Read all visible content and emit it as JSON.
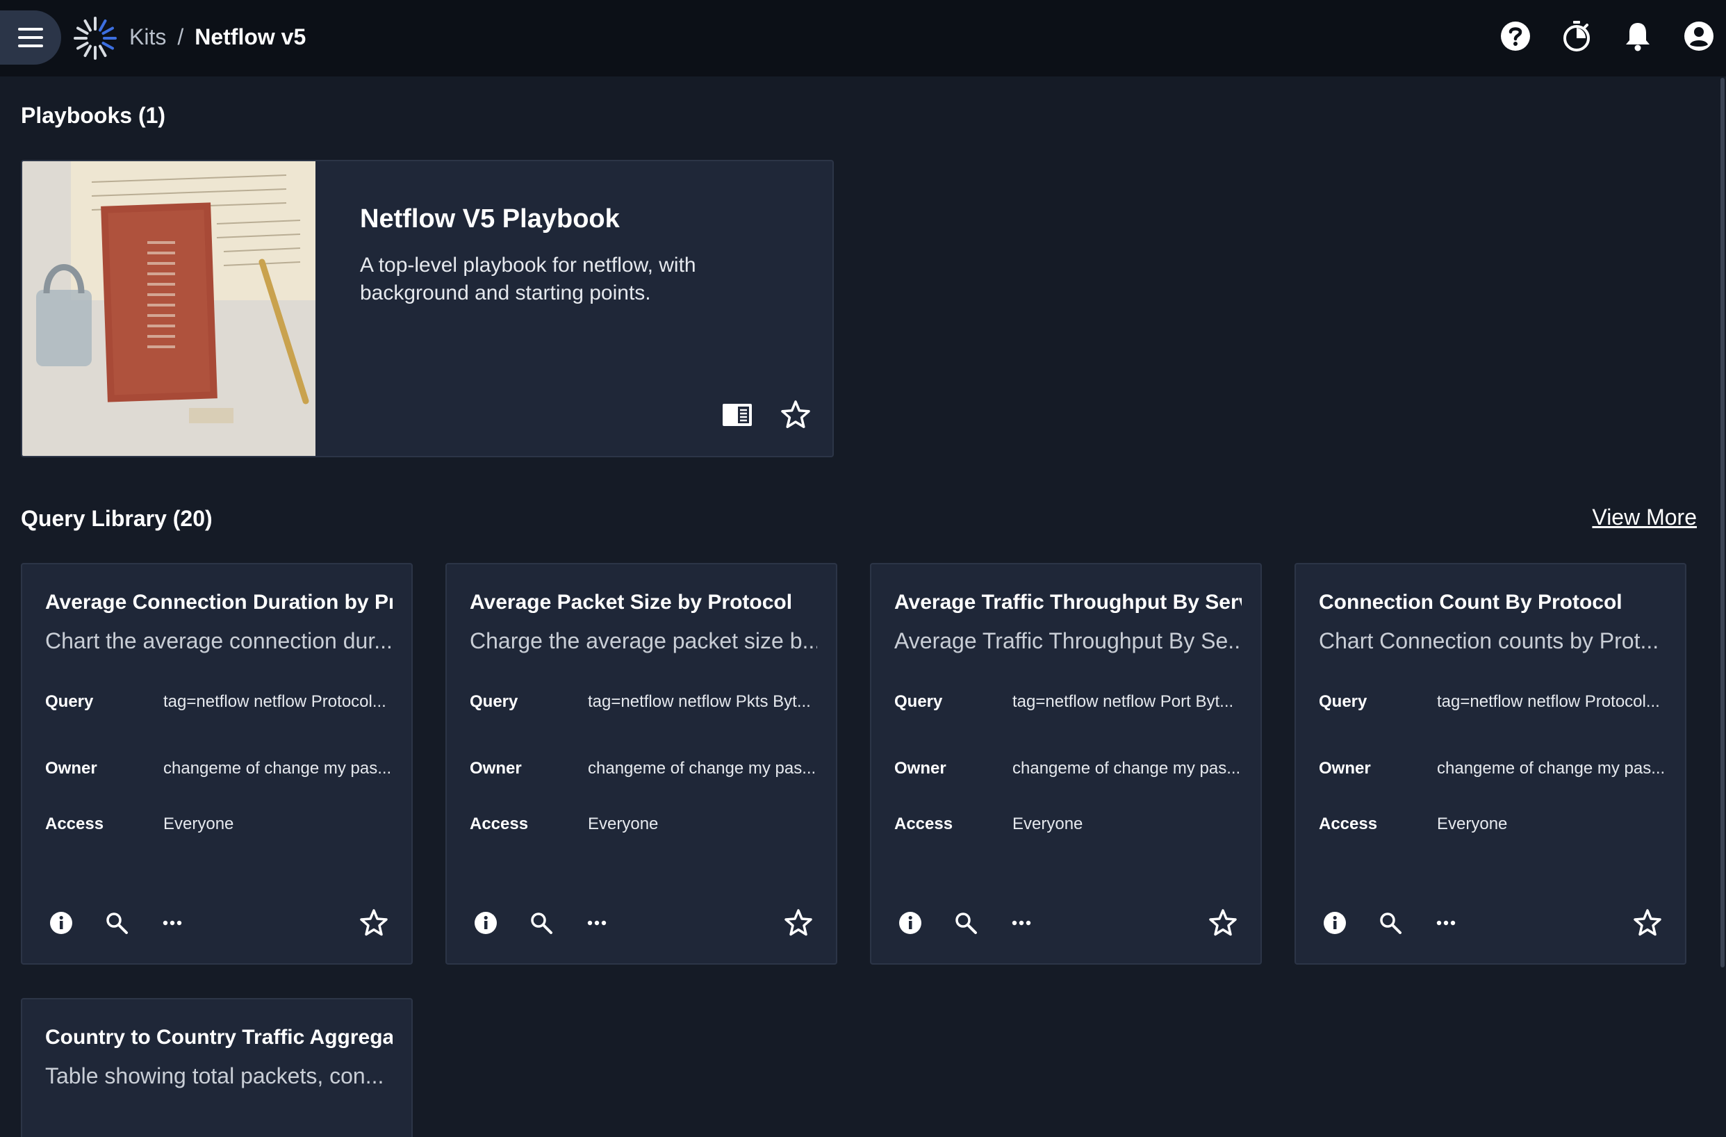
{
  "header": {
    "breadcrumb_parent": "Kits",
    "breadcrumb_separator": "/",
    "breadcrumb_current": "Netflow v5",
    "icons": [
      "help-icon",
      "timer-icon",
      "notifications-icon",
      "account-icon"
    ]
  },
  "playbooks": {
    "heading": "Playbooks (1)",
    "card": {
      "title": "Netflow V5 Playbook",
      "description": "A top-level playbook for netflow, with background and starting points."
    }
  },
  "query_library": {
    "heading": "Query Library (20)",
    "view_more": "View More",
    "labels": {
      "query": "Query",
      "owner": "Owner",
      "access": "Access"
    },
    "cards": [
      {
        "title": "Average Connection Duration by Pr...",
        "subtitle": "Chart the average connection dur...",
        "query": "tag=netflow netflow Protocol...",
        "owner": "changeme of change my pas...",
        "access": "Everyone"
      },
      {
        "title": "Average Packet Size by Protocol",
        "subtitle": "Charge the average packet size b...",
        "query": "tag=netflow netflow Pkts Byt...",
        "owner": "changeme of change my pas...",
        "access": "Everyone"
      },
      {
        "title": "Average Traffic Throughput By Serv...",
        "subtitle": "Average Traffic Throughput By Se...",
        "query": "tag=netflow netflow Port Byt...",
        "owner": "changeme of change my pas...",
        "access": "Everyone"
      },
      {
        "title": "Connection Count By Protocol",
        "subtitle": "Chart Connection counts by Prot...",
        "query": "tag=netflow netflow Protocol...",
        "owner": "changeme of change my pas...",
        "access": "Everyone"
      },
      {
        "title": "Country to Country Traffic Aggrega...",
        "subtitle": "Table showing total packets, con..."
      }
    ]
  }
}
